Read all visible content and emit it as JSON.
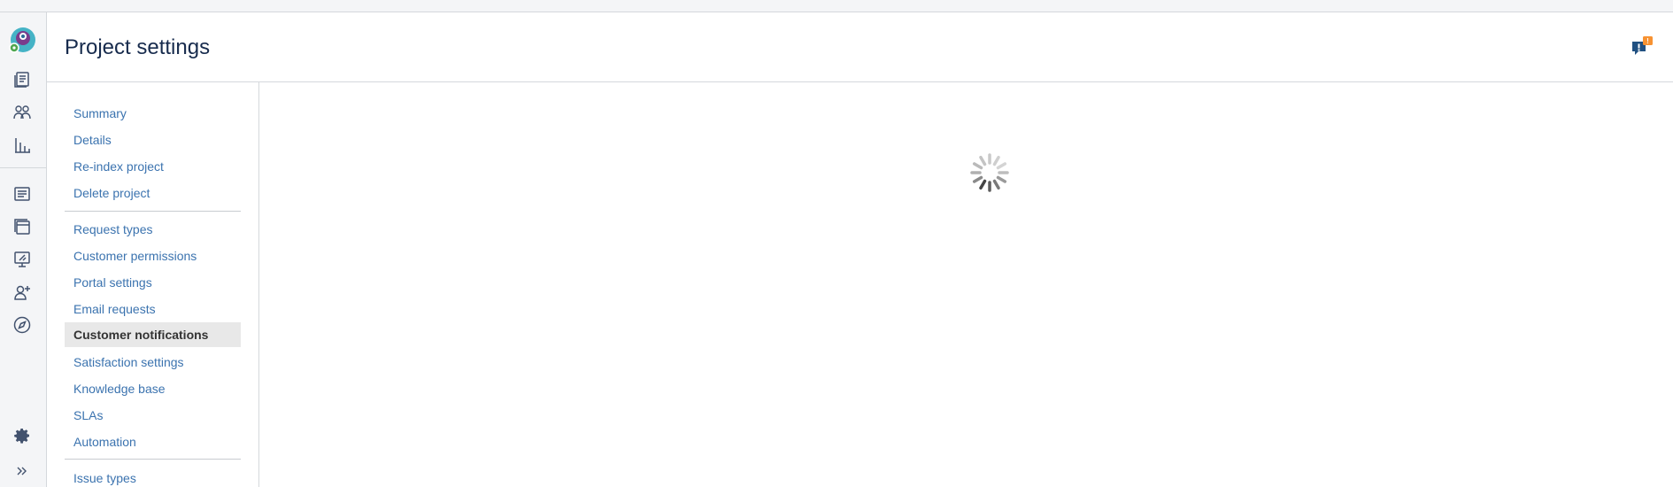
{
  "page": {
    "title": "Project settings"
  },
  "rail": {
    "icons": [
      "avatar-icon",
      "queues-icon",
      "customers-icon",
      "reports-icon",
      "raise-request-icon",
      "knowledge-base-icon",
      "channels-icon",
      "invite-team-icon",
      "compass-icon",
      "settings-icon",
      "expand-icon"
    ]
  },
  "header": {
    "feedback_badge": "!"
  },
  "nav": {
    "group1": [
      "Summary",
      "Details",
      "Re-index project",
      "Delete project"
    ],
    "group2": [
      "Request types",
      "Customer permissions",
      "Portal settings",
      "Email requests",
      "Customer notifications",
      "Satisfaction settings",
      "Knowledge base",
      "SLAs",
      "Automation"
    ],
    "group3": [
      "Issue types"
    ],
    "active": "Customer notifications"
  },
  "content": {
    "state": "loading"
  },
  "colors": {
    "link": "#3b73af",
    "title": "#172b4d",
    "active_bg": "#e8e8e8",
    "rail_bg": "#f4f5f7",
    "badge": "#f79232",
    "feedback_icon": "#205081"
  }
}
